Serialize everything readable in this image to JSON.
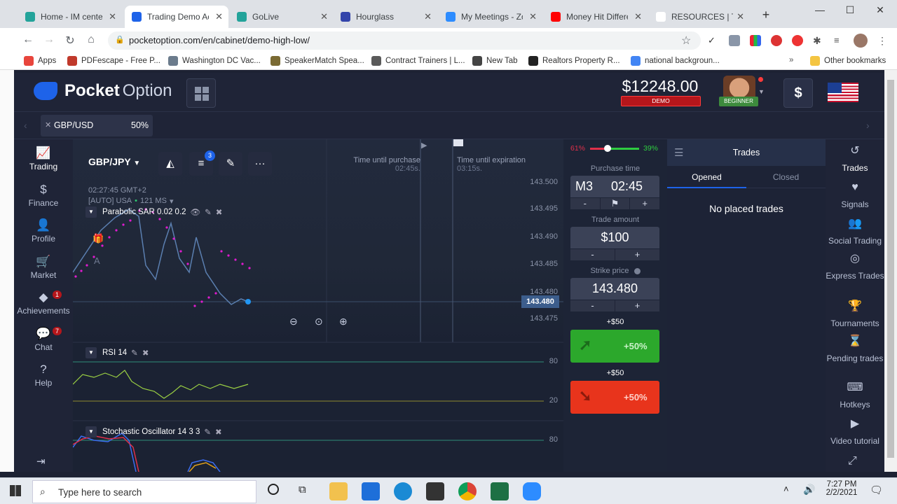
{
  "browser": {
    "tabs": [
      {
        "label": "Home - IM center",
        "color": "#23a39a"
      },
      {
        "label": "Trading Demo Ac",
        "color": "#1e63e9",
        "active": true
      },
      {
        "label": "GoLive",
        "color": "#23a39a"
      },
      {
        "label": "Hourglass",
        "color": "#3344aa"
      },
      {
        "label": "My Meetings - Zo",
        "color": "#2d8cff"
      },
      {
        "label": "Money Hit Differe",
        "color": "#ff0000"
      },
      {
        "label": "RESOURCES | Trac",
        "color": "#ffffff"
      }
    ],
    "url": "pocketoption.com/en/cabinet/demo-high-low/",
    "bookmarks": [
      {
        "label": "Apps",
        "color": "#e8453c"
      },
      {
        "label": "PDFescape - Free P...",
        "color": "#c0392b"
      },
      {
        "label": "Washington DC Vac...",
        "color": "#6b7b8c"
      },
      {
        "label": "SpeakerMatch Spea...",
        "color": "#7a6a33"
      },
      {
        "label": "Contract Trainers | L...",
        "color": "#5a5a5a"
      },
      {
        "label": "New Tab",
        "color": "#444"
      },
      {
        "label": "Realtors Property R...",
        "color": "#222"
      },
      {
        "label": "national backgroun...",
        "color": "#4285f4"
      }
    ],
    "other_bookmarks": "Other bookmarks"
  },
  "header": {
    "logo_main": "Pocket",
    "logo_sub": "Option",
    "balance": "$12248.00",
    "account_type": "DEMO",
    "level": "BEGINNER",
    "currency_icon": "$"
  },
  "assetbar": {
    "pair": "GBP/USD",
    "percent": "50%"
  },
  "left_nav": [
    {
      "label": "Trading",
      "icon": "chart-icon",
      "glyph": "📈"
    },
    {
      "label": "Finance",
      "icon": "dollar-icon",
      "glyph": "$"
    },
    {
      "label": "Profile",
      "icon": "user-icon",
      "glyph": "👤"
    },
    {
      "label": "Market",
      "icon": "cart-icon",
      "glyph": "🛒"
    },
    {
      "label": "Achievements",
      "icon": "diamond-icon",
      "glyph": "◆",
      "badge": "1"
    },
    {
      "label": "Chat",
      "icon": "chat-icon",
      "glyph": "💬",
      "badge": "7"
    },
    {
      "label": "Help",
      "icon": "help-icon",
      "glyph": "?"
    }
  ],
  "chart": {
    "pair": "GBP/JPY",
    "settings_badge": "3",
    "time": "02:27:45 GMT+2",
    "auto_line": "[AUTO] USA",
    "latency": "121 MS",
    "time_until_purchase_label": "Time until purchase",
    "time_until_purchase": "02:45s.",
    "time_until_expiration_label": "Time until expiration",
    "time_until_expiration": "03:15s.",
    "price_ticks": [
      "143.500",
      "143.495",
      "143.490",
      "143.485",
      "143.480",
      "143.475"
    ],
    "current_price": "143.480",
    "indicators": [
      {
        "name": "Parabolic SAR 0.02 0.2"
      },
      {
        "name": "RSI 14",
        "levels": [
          "80",
          "20"
        ]
      },
      {
        "name": "Stochastic Oscillator 14 3 3",
        "levels": [
          "80"
        ]
      }
    ]
  },
  "panel": {
    "sentiment_low": "61%",
    "sentiment_high": "39%",
    "purchase_time_label": "Purchase time",
    "timeframe": "M3",
    "purchase_time": "02:45",
    "trade_amount_label": "Trade amount",
    "trade_amount": "$100",
    "strike_label": "Strike price",
    "strike_price": "143.480",
    "payout_up": "+$50",
    "payout_down": "+$50",
    "up_percent": "+50%",
    "down_percent": "+50%",
    "minus": "-",
    "plus": "+"
  },
  "trades": {
    "title": "Trades",
    "tab_opened": "Opened",
    "tab_closed": "Closed",
    "empty": "No placed trades"
  },
  "right_nav": [
    {
      "label": "Trades",
      "icon": "history-icon",
      "glyph": "↺"
    },
    {
      "label": "Signals",
      "icon": "signals-icon",
      "glyph": "♥"
    },
    {
      "label": "Social Trading",
      "icon": "social-icon",
      "glyph": "👥"
    },
    {
      "label": "Express Trades",
      "icon": "express-icon",
      "glyph": "◎"
    },
    {
      "label": "Tournaments",
      "icon": "trophy-icon",
      "glyph": "🏆"
    },
    {
      "label": "Pending trades",
      "icon": "hourglass-icon",
      "glyph": "⌛"
    },
    {
      "label": "Hotkeys",
      "icon": "keyboard-icon",
      "glyph": "⌨"
    },
    {
      "label": "Video tutorial",
      "icon": "video-icon",
      "glyph": "▶"
    }
  ],
  "taskbar": {
    "search_placeholder": "Type here to search",
    "time": "7:27 PM",
    "date": "2/2/2021"
  }
}
